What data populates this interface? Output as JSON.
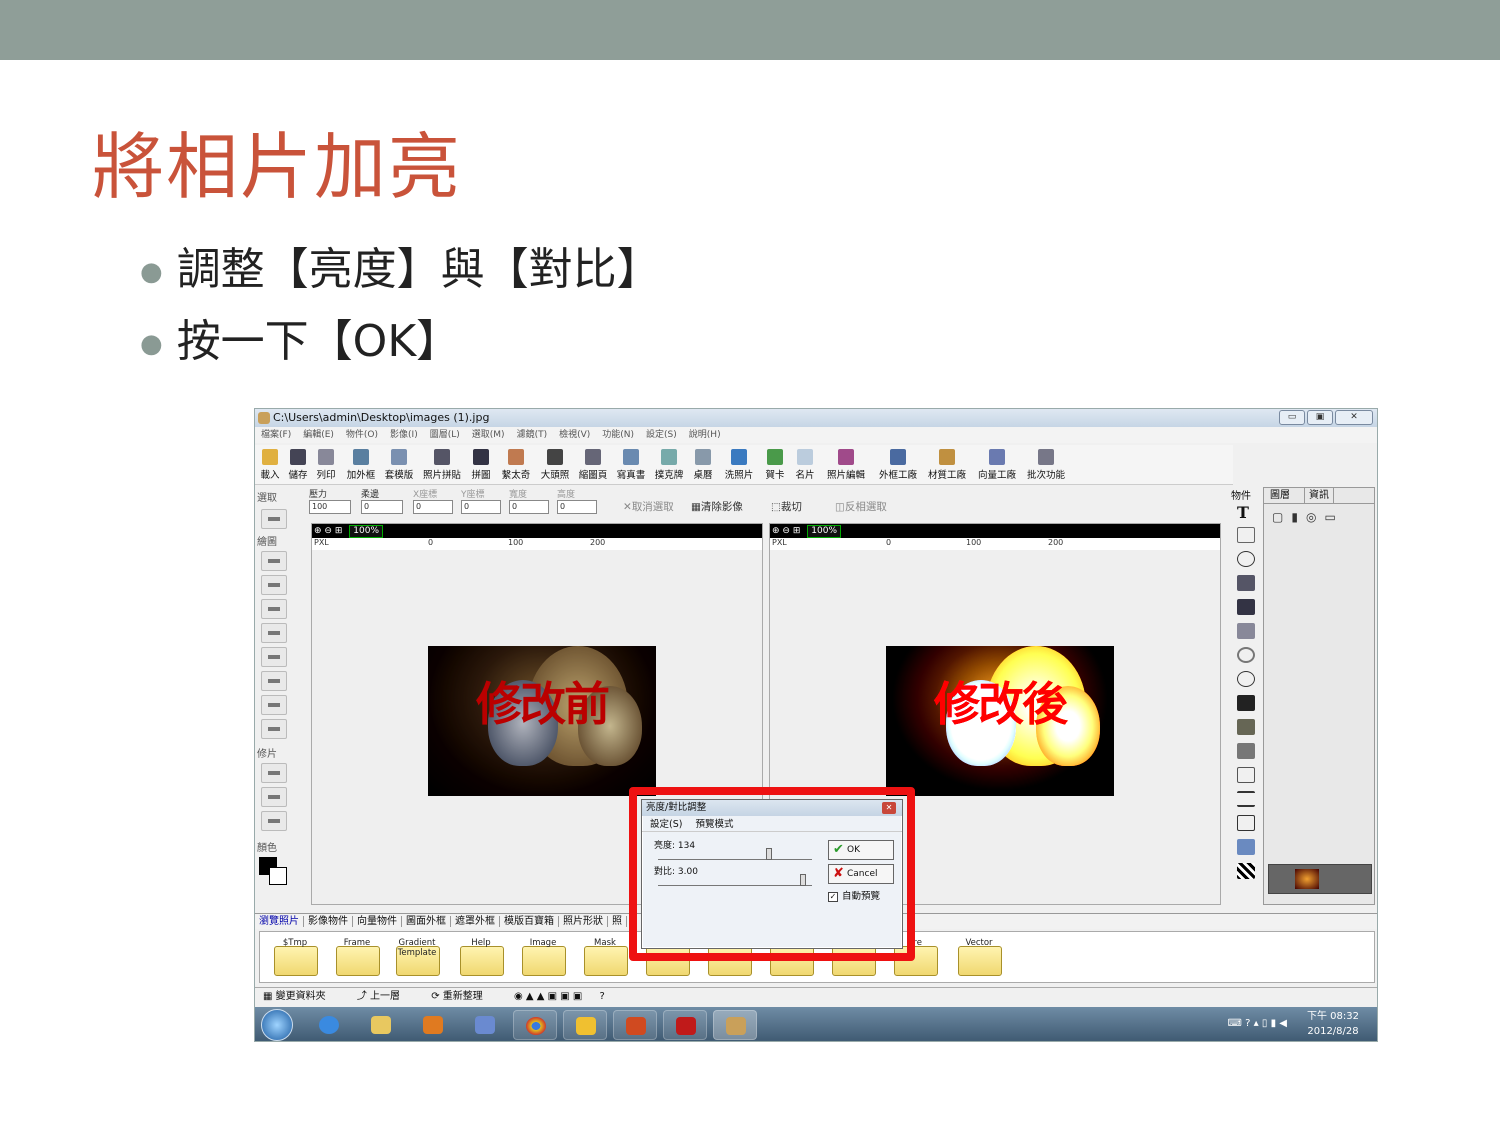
{
  "slide": {
    "title": "將相片加亮",
    "bullets": [
      "調整【亮度】與【對比】",
      "按一下【OK】"
    ],
    "colors": {
      "band": "#8f9e98",
      "title": "#c9533a",
      "highlight": "#ee1111"
    }
  },
  "window": {
    "title": "C:\\Users\\admin\\Desktop\\images (1).jpg",
    "menu": [
      "檔案(F)",
      "編輯(E)",
      "物件(O)",
      "影像(I)",
      "圖層(L)",
      "選取(M)",
      "濾鏡(T)",
      "檢視(V)",
      "功能(N)",
      "設定(S)",
      "說明(H)"
    ]
  },
  "toolbar": [
    "載入",
    "儲存",
    "列印",
    "加外框",
    "套模版",
    "照片拼貼",
    "拼圖",
    "繫太奇",
    "大頭照",
    "縮圖頁",
    "寫真書",
    "撲克牌",
    "桌曆",
    "洗照片",
    "賀卡",
    "名片",
    "照片編輯",
    "外框工廠",
    "材質工廠",
    "向量工廠",
    "批次功能"
  ],
  "options": {
    "labels": [
      "壓力",
      "柔邊",
      "X座標",
      "Y座標",
      "寬度",
      "高度"
    ],
    "values": [
      "100",
      "0",
      "0",
      "0",
      "0",
      "0"
    ],
    "cancel_select": "取消選取",
    "clear_image": "清除影像",
    "crop": "裁切",
    "invert_select": "反相選取"
  },
  "left_panel": {
    "select": "選取",
    "draw": "繪圖",
    "retouch": "修片",
    "color": "顏色"
  },
  "panes": {
    "zoom": "100%",
    "unit": "PXL",
    "ruler_ticks": [
      "0",
      "100",
      "200"
    ],
    "before_label": "修改前",
    "after_label": "修改後"
  },
  "right_panel": {
    "object_header": "物件",
    "tabs": [
      "圖層",
      "資訊"
    ]
  },
  "dialog": {
    "title": "亮度/對比調整",
    "menu": [
      "設定(S)",
      "預覽模式"
    ],
    "brightness_label": "亮度: 134",
    "contrast_label": "對比: 3.00",
    "brightness_level": 0.73,
    "contrast_level": 0.96,
    "ok": "OK",
    "cancel": "Cancel",
    "auto_preview": "自動預覽",
    "auto_preview_checked": true
  },
  "bottom_tabs": [
    "瀏覽照片",
    "影像物件",
    "向量物件",
    "圖面外框",
    "遮罩外框",
    "模版百寶箱",
    "照片形狀",
    "照"
  ],
  "folders": [
    "$Tmp",
    "Frame",
    "Gradient Template",
    "Help",
    "Image",
    "Mask",
    "",
    "",
    "",
    "",
    "ure",
    "Vector"
  ],
  "statusbar": [
    "變更資料夾",
    "上一層",
    "重新整理",
    "?"
  ],
  "taskbar": {
    "time": "下午 08:32",
    "date": "2012/8/28"
  }
}
